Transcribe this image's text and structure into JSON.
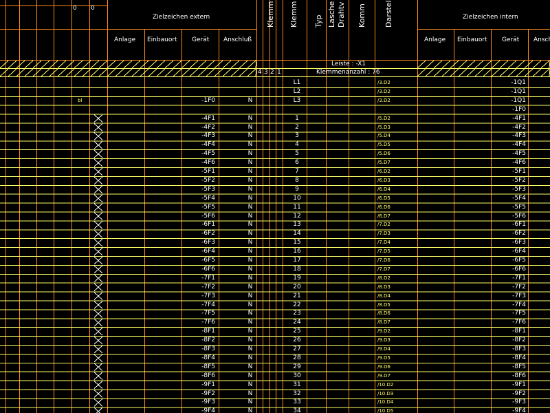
{
  "header": {
    "ziel_extern": "Zielzeichen extern",
    "ziel_intern": "Zielzeichen intern",
    "ext_cols": [
      "Anlage",
      "Einbauort",
      "Gerät",
      "Anschluß"
    ],
    "int_cols": [
      "Anlage",
      "Einbauort",
      "Gerät",
      "Ansch"
    ],
    "vertical": [
      "Klemm",
      "Klemm",
      "Typ",
      "Lasche",
      "Drahtv",
      "Komm",
      "Darstel"
    ],
    "top_marks": [
      "0",
      "0"
    ],
    "leiste": "Leiste : -X1",
    "klemmenanzahl": "Klemmenanzahl : 76",
    "bridge_nums": [
      "4",
      "3",
      "2",
      "1"
    ]
  },
  "rows": [
    {
      "ext_geraet": "",
      "anschluss": "",
      "klemme": "L1",
      "darst": "/3.D2",
      "int_geraet": "-1Q1",
      "mark": "",
      "cross": false
    },
    {
      "ext_geraet": "",
      "anschluss": "",
      "klemme": "L2",
      "darst": "/3.D2",
      "int_geraet": "-1Q1",
      "mark": "",
      "cross": false
    },
    {
      "ext_geraet": "-1F0",
      "anschluss": "N",
      "klemme": "L3",
      "darst": "/3.D2",
      "int_geraet": "-1Q1",
      "mark": "bl",
      "cross": false
    },
    {
      "ext_geraet": "",
      "anschluss": "",
      "klemme": "",
      "darst": "",
      "int_geraet": "-1F0",
      "mark": "",
      "cross": false
    },
    {
      "ext_geraet": "-4F1",
      "anschluss": "N",
      "klemme": "1",
      "darst": "/5.D2",
      "int_geraet": "-4F1",
      "mark": "",
      "cross": true
    },
    {
      "ext_geraet": "-4F2",
      "anschluss": "N",
      "klemme": "2",
      "darst": "/5.D3",
      "int_geraet": "-4F2",
      "mark": "",
      "cross": true
    },
    {
      "ext_geraet": "-4F3",
      "anschluss": "N",
      "klemme": "3",
      "darst": "/5.D4",
      "int_geraet": "-4F3",
      "mark": "",
      "cross": true
    },
    {
      "ext_geraet": "-4F4",
      "anschluss": "N",
      "klemme": "4",
      "darst": "/5.D5",
      "int_geraet": "-4F4",
      "mark": "",
      "cross": true
    },
    {
      "ext_geraet": "-4F5",
      "anschluss": "N",
      "klemme": "5",
      "darst": "/5.D6",
      "int_geraet": "-4F5",
      "mark": "",
      "cross": true
    },
    {
      "ext_geraet": "-4F6",
      "anschluss": "N",
      "klemme": "6",
      "darst": "/5.D7",
      "int_geraet": "-4F6",
      "mark": "",
      "cross": true
    },
    {
      "ext_geraet": "-5F1",
      "anschluss": "N",
      "klemme": "7",
      "darst": "/6.D2",
      "int_geraet": "-5F1",
      "mark": "",
      "cross": true
    },
    {
      "ext_geraet": "-5F2",
      "anschluss": "N",
      "klemme": "8",
      "darst": "/6.D3",
      "int_geraet": "-5F2",
      "mark": "",
      "cross": true
    },
    {
      "ext_geraet": "-5F3",
      "anschluss": "N",
      "klemme": "9",
      "darst": "/6.D4",
      "int_geraet": "-5F3",
      "mark": "",
      "cross": true
    },
    {
      "ext_geraet": "-5F4",
      "anschluss": "N",
      "klemme": "10",
      "darst": "/6.D5",
      "int_geraet": "-5F4",
      "mark": "",
      "cross": true
    },
    {
      "ext_geraet": "-5F5",
      "anschluss": "N",
      "klemme": "11",
      "darst": "/6.D6",
      "int_geraet": "-5F5",
      "mark": "",
      "cross": true
    },
    {
      "ext_geraet": "-5F6",
      "anschluss": "N",
      "klemme": "12",
      "darst": "/6.D7",
      "int_geraet": "-5F6",
      "mark": "",
      "cross": true
    },
    {
      "ext_geraet": "-6F1",
      "anschluss": "N",
      "klemme": "13",
      "darst": "/7.D2",
      "int_geraet": "-6F1",
      "mark": "",
      "cross": true
    },
    {
      "ext_geraet": "-6F2",
      "anschluss": "N",
      "klemme": "14",
      "darst": "/7.D3",
      "int_geraet": "-6F2",
      "mark": "",
      "cross": true
    },
    {
      "ext_geraet": "-6F3",
      "anschluss": "N",
      "klemme": "15",
      "darst": "/7.D4",
      "int_geraet": "-6F3",
      "mark": "",
      "cross": true
    },
    {
      "ext_geraet": "-6F4",
      "anschluss": "N",
      "klemme": "16",
      "darst": "/7.D5",
      "int_geraet": "-6F4",
      "mark": "",
      "cross": true
    },
    {
      "ext_geraet": "-6F5",
      "anschluss": "N",
      "klemme": "17",
      "darst": "/7.D6",
      "int_geraet": "-6F5",
      "mark": "",
      "cross": true
    },
    {
      "ext_geraet": "-6F6",
      "anschluss": "N",
      "klemme": "18",
      "darst": "/7.D7",
      "int_geraet": "-6F6",
      "mark": "",
      "cross": true
    },
    {
      "ext_geraet": "-7F1",
      "anschluss": "N",
      "klemme": "19",
      "darst": "/8.D2",
      "int_geraet": "-7F1",
      "mark": "",
      "cross": true
    },
    {
      "ext_geraet": "-7F2",
      "anschluss": "N",
      "klemme": "20",
      "darst": "/8.D3",
      "int_geraet": "-7F2",
      "mark": "",
      "cross": true
    },
    {
      "ext_geraet": "-7F3",
      "anschluss": "N",
      "klemme": "21",
      "darst": "/8.D4",
      "int_geraet": "-7F3",
      "mark": "",
      "cross": true
    },
    {
      "ext_geraet": "-7F4",
      "anschluss": "N",
      "klemme": "22",
      "darst": "/8.D5",
      "int_geraet": "-7F4",
      "mark": "",
      "cross": true
    },
    {
      "ext_geraet": "-7F5",
      "anschluss": "N",
      "klemme": "23",
      "darst": "/8.D6",
      "int_geraet": "-7F5",
      "mark": "",
      "cross": true
    },
    {
      "ext_geraet": "-7F6",
      "anschluss": "N",
      "klemme": "24",
      "darst": "/8.D7",
      "int_geraet": "-7F6",
      "mark": "",
      "cross": true
    },
    {
      "ext_geraet": "-8F1",
      "anschluss": "N",
      "klemme": "25",
      "darst": "/9.D2",
      "int_geraet": "-8F1",
      "mark": "",
      "cross": true
    },
    {
      "ext_geraet": "-8F2",
      "anschluss": "N",
      "klemme": "26",
      "darst": "/9.D3",
      "int_geraet": "-8F2",
      "mark": "",
      "cross": true
    },
    {
      "ext_geraet": "-8F3",
      "anschluss": "N",
      "klemme": "27",
      "darst": "/9.D4",
      "int_geraet": "-8F3",
      "mark": "",
      "cross": true
    },
    {
      "ext_geraet": "-8F4",
      "anschluss": "N",
      "klemme": "28",
      "darst": "/9.D5",
      "int_geraet": "-8F4",
      "mark": "",
      "cross": true
    },
    {
      "ext_geraet": "-8F5",
      "anschluss": "N",
      "klemme": "29",
      "darst": "/9.D6",
      "int_geraet": "-8F5",
      "mark": "",
      "cross": true
    },
    {
      "ext_geraet": "-8F6",
      "anschluss": "N",
      "klemme": "30",
      "darst": "/9.D7",
      "int_geraet": "-8F6",
      "mark": "",
      "cross": true
    },
    {
      "ext_geraet": "-9F1",
      "anschluss": "N",
      "klemme": "31",
      "darst": "/10.D2",
      "int_geraet": "-9F1",
      "mark": "",
      "cross": true
    },
    {
      "ext_geraet": "-9F2",
      "anschluss": "N",
      "klemme": "32",
      "darst": "/10.D3",
      "int_geraet": "-9F2",
      "mark": "",
      "cross": true
    },
    {
      "ext_geraet": "-9F3",
      "anschluss": "N",
      "klemme": "33",
      "darst": "/10.D4",
      "int_geraet": "-9F3",
      "mark": "",
      "cross": true
    },
    {
      "ext_geraet": "-9F4",
      "anschluss": "N",
      "klemme": "34",
      "darst": "/10.D5",
      "int_geraet": "-9F4",
      "mark": "",
      "cross": true
    }
  ],
  "colors": {
    "background": "#000000",
    "grid_orange": "#ff8c1a",
    "grid_yellow": "#ffff66",
    "text": "#ffffff"
  }
}
